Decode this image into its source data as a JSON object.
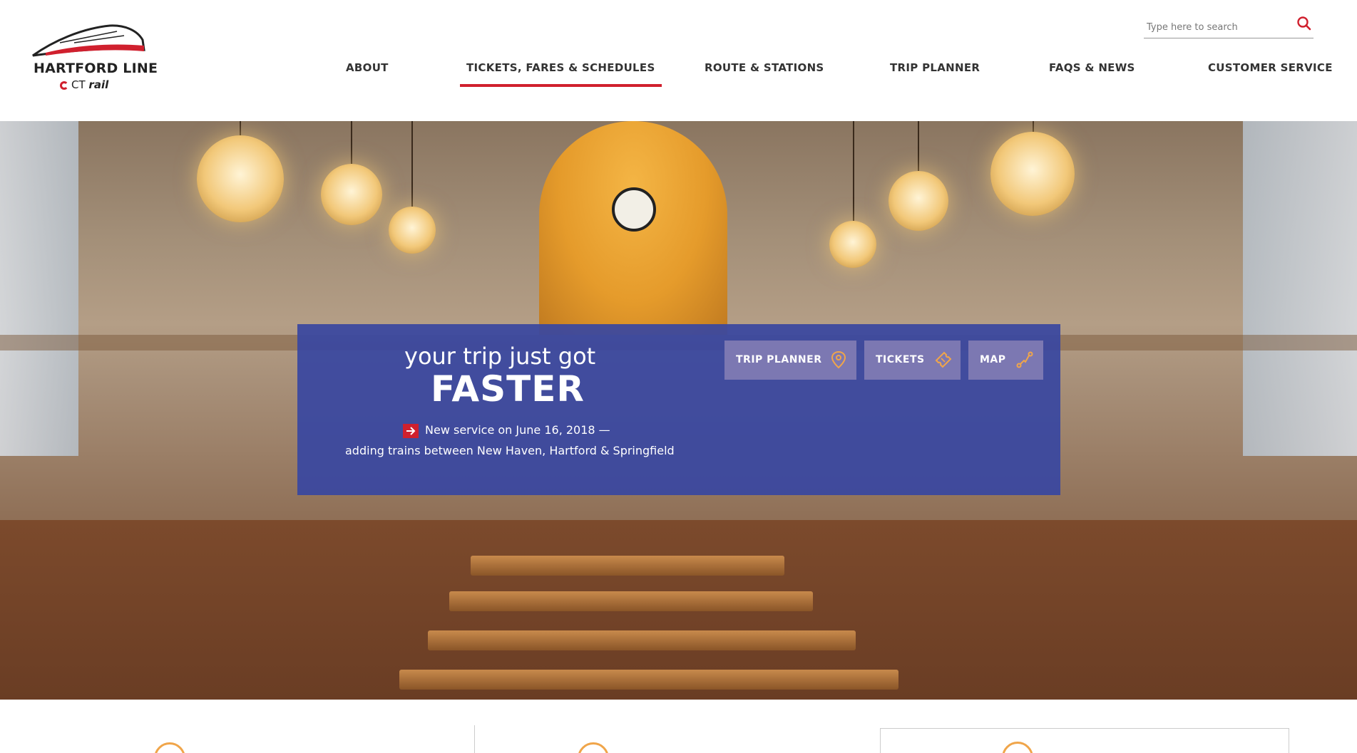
{
  "brand": {
    "title": "HARTFORD LINE",
    "sub_prefix": "CT",
    "sub_bold": "rail",
    "accent": "#d0202e",
    "navy": "#3947a0"
  },
  "search": {
    "placeholder": "Type here to search",
    "icon": "search-icon"
  },
  "nav": {
    "items": [
      {
        "label": "ABOUT",
        "active": false
      },
      {
        "label": "TICKETS, FARES & SCHEDULES",
        "active": true
      },
      {
        "label": "ROUTE & STATIONS",
        "active": false
      },
      {
        "label": "TRIP PLANNER",
        "active": false
      },
      {
        "label": "FAQS & NEWS",
        "active": false
      },
      {
        "label": "CUSTOMER SERVICE",
        "active": false
      }
    ]
  },
  "hero": {
    "headline_1": "your trip just got",
    "headline_2": "FASTER",
    "service_line_1": "New service on June 16, 2018 —",
    "service_line_2": "adding trains between New Haven, Hartford & Springfield",
    "quick_links": [
      {
        "label": "TRIP PLANNER",
        "icon": "map-pin-icon"
      },
      {
        "label": "TICKETS",
        "icon": "ticket-icon"
      },
      {
        "label": "MAP",
        "icon": "route-icon"
      }
    ]
  }
}
